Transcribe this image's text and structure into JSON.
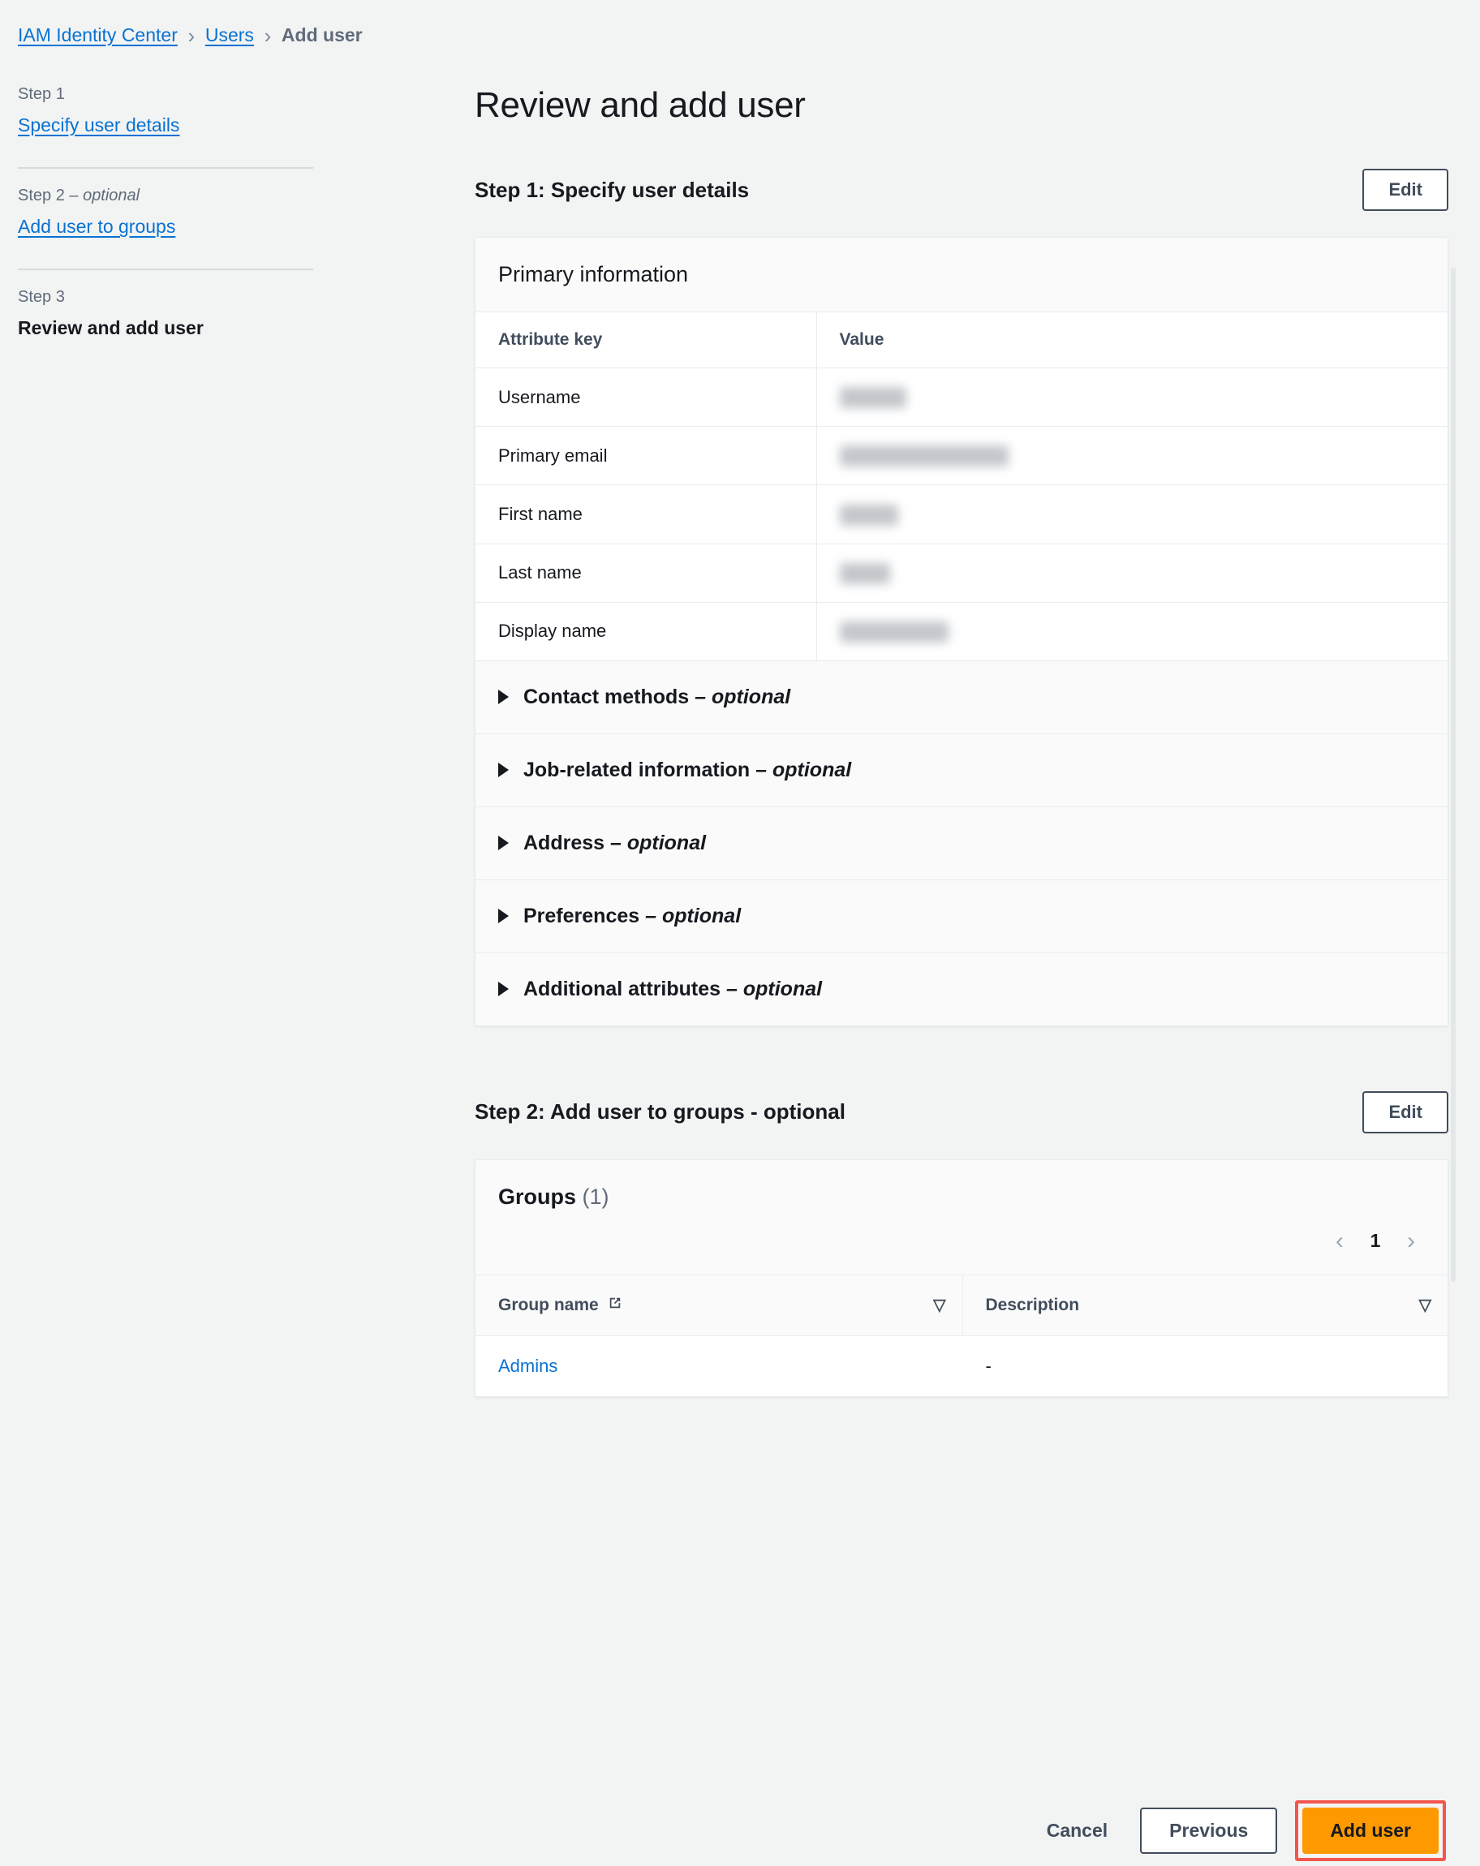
{
  "breadcrumb": {
    "items": [
      {
        "label": "IAM Identity Center",
        "type": "link"
      },
      {
        "label": "Users",
        "type": "link"
      },
      {
        "label": "Add user",
        "type": "current"
      }
    ],
    "separator": "›"
  },
  "sidebar": {
    "steps": [
      {
        "step_label": "Step 1",
        "optional_suffix": "",
        "title": "Specify user details",
        "state": "link"
      },
      {
        "step_label": "Step 2",
        "optional_suffix": " – optional",
        "title": "Add user to groups",
        "state": "link"
      },
      {
        "step_label": "Step 3",
        "optional_suffix": "",
        "title": "Review and add user",
        "state": "active"
      }
    ]
  },
  "main": {
    "page_title": "Review and add user",
    "step1": {
      "heading": "Step 1: Specify user details",
      "edit_label": "Edit",
      "card_title": "Primary information",
      "columns": {
        "key": "Attribute key",
        "value": "Value"
      },
      "rows": [
        {
          "key": "Username",
          "value": "",
          "redacted": true,
          "redact_width": 82
        },
        {
          "key": "Primary email",
          "value": "",
          "redacted": true,
          "redact_width": 208
        },
        {
          "key": "First name",
          "value": "",
          "redacted": true,
          "redact_width": 72
        },
        {
          "key": "Last name",
          "value": "",
          "redacted": true,
          "redact_width": 62
        },
        {
          "key": "Display name",
          "value": "",
          "redacted": true,
          "redact_width": 134
        }
      ],
      "expanders": [
        {
          "label": "Contact methods",
          "optional": " – optional",
          "expanded": false
        },
        {
          "label": "Job-related information",
          "optional": " – optional",
          "expanded": false
        },
        {
          "label": "Address",
          "optional": " – optional",
          "expanded": false
        },
        {
          "label": "Preferences",
          "optional": " – optional",
          "expanded": false
        },
        {
          "label": "Additional attributes",
          "optional": " – optional",
          "expanded": false
        }
      ]
    },
    "step2": {
      "heading": "Step 2: Add user to groups - optional",
      "edit_label": "Edit",
      "groups_title": "Groups",
      "groups_count": "(1)",
      "pagination": {
        "prev": "‹",
        "page": "1",
        "next": "›"
      },
      "columns": {
        "group_name": "Group name",
        "description": "Description"
      },
      "sort_glyph": "▽",
      "rows": [
        {
          "group_name": "Admins",
          "description": "-"
        }
      ]
    }
  },
  "footer": {
    "cancel_label": "Cancel",
    "previous_label": "Previous",
    "add_user_label": "Add user"
  },
  "colors": {
    "background": "#f2f3f3",
    "link": "#0972d3",
    "text": "#16191f",
    "muted": "#5f6b7a",
    "border": "#e9ebed",
    "primary_button": "#ff9900",
    "highlight_outline": "#f2564d",
    "button_outline": "#414d5c"
  }
}
